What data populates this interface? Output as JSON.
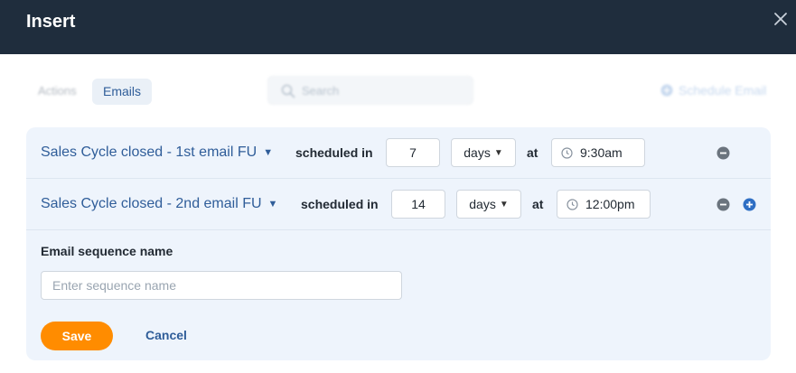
{
  "dialog": {
    "title": "Insert"
  },
  "toolbar": {
    "tabs": [
      {
        "label": "Actions"
      },
      {
        "label": "Emails"
      }
    ],
    "search_placeholder": "Search",
    "schedule_label": "Schedule Email"
  },
  "rows": [
    {
      "sequence": "Sales Cycle closed - 1st email FU",
      "scheduled_label": "scheduled in",
      "amount": "7",
      "unit": "days",
      "at_label": "at",
      "time": "9:30am"
    },
    {
      "sequence": "Sales Cycle closed - 2nd email FU",
      "scheduled_label": "scheduled in",
      "amount": "14",
      "unit": "days",
      "at_label": "at",
      "time": "12:00pm"
    }
  ],
  "form": {
    "name_label": "Email sequence name",
    "name_placeholder": "Enter sequence name",
    "save_label": "Save",
    "cancel_label": "Cancel"
  },
  "colors": {
    "header": "#1f2d3d",
    "accent": "#2f5d99",
    "save": "#ff8c00",
    "panel": "#eef4fc"
  }
}
